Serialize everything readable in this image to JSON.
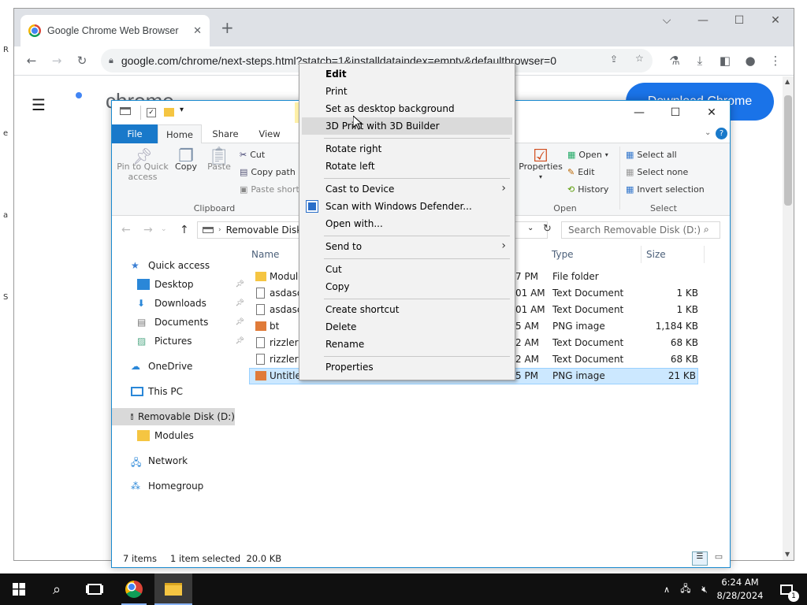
{
  "desktop_icons": [
    {
      "label": "R"
    },
    {
      "label": "e"
    },
    {
      "label": "a"
    },
    {
      "label": "S"
    }
  ],
  "chrome": {
    "tab_title": "Google Chrome Web Browser",
    "url": "google.com/chrome/next-steps.html?statcb=1&installdataindex=empty&defaultbrowser=0",
    "page_brand": "chrome",
    "download_button": "Download Chrome"
  },
  "explorer": {
    "ribbon_tabs": [
      "File",
      "Home",
      "Share",
      "View"
    ],
    "clipboard": {
      "pin_label_1": "Pin to Quick",
      "pin_label_2": "access",
      "copy": "Copy",
      "paste": "Paste",
      "cut": "Cut",
      "copy_path": "Copy path",
      "paste_shortcut": "Paste short",
      "group": "Clipboard"
    },
    "open_group": {
      "properties": "Properties",
      "open": "Open",
      "edit": "Edit",
      "history": "History",
      "group": "Open"
    },
    "select_group": {
      "select_all": "Select all",
      "select_none": "Select none",
      "invert": "Invert selection",
      "group": "Select"
    },
    "address": "Removable Disk (",
    "search_placeholder": "Search Removable Disk (D:)",
    "nav": {
      "quick_access": "Quick access",
      "desktop": "Desktop",
      "downloads": "Downloads",
      "documents": "Documents",
      "pictures": "Pictures",
      "onedrive": "OneDrive",
      "this_pc": "This PC",
      "removable": "Removable Disk (D:)",
      "modules": "Modules",
      "network": "Network",
      "homegroup": "Homegroup"
    },
    "columns": {
      "name": "Name",
      "type": "Type",
      "size": "Size"
    },
    "files": [
      {
        "name": "Module",
        "time": "7 PM",
        "type": "File folder",
        "size": ""
      },
      {
        "name": "asdasda",
        "time": "01 AM",
        "type": "Text Document",
        "size": "1 KB"
      },
      {
        "name": "asdasda",
        "time": "01 AM",
        "type": "Text Document",
        "size": "1 KB"
      },
      {
        "name": "bt",
        "time": "5 AM",
        "type": "PNG image",
        "size": "1,184 KB"
      },
      {
        "name": "rizzler d",
        "time": "2 AM",
        "type": "Text Document",
        "size": "68 KB"
      },
      {
        "name": "rizzler d",
        "time": "2 AM",
        "type": "Text Document",
        "size": "68 KB"
      },
      {
        "name": "Untitled",
        "time": "5 PM",
        "type": "PNG image",
        "size": "21 KB"
      }
    ],
    "status": {
      "items": "7 items",
      "selected": "1 item selected  20.0 KB"
    }
  },
  "context_menu": {
    "edit": "Edit",
    "print": "Print",
    "set_bg": "Set as desktop background",
    "print3d": "3D Print with 3D Builder",
    "rotate_right": "Rotate right",
    "rotate_left": "Rotate left",
    "cast": "Cast to Device",
    "scan": "Scan with Windows Defender...",
    "open_with": "Open with...",
    "send_to": "Send to",
    "cut": "Cut",
    "copy": "Copy",
    "create_shortcut": "Create shortcut",
    "delete": "Delete",
    "rename": "Rename",
    "properties": "Properties"
  },
  "taskbar": {
    "time": "6:24 AM",
    "date": "8/28/2024",
    "notifications": "1"
  },
  "colors": {
    "accent": "#1a73e8",
    "file_tab": "#1979ca",
    "selection": "#cce8ff",
    "taskbar": "#101010"
  }
}
